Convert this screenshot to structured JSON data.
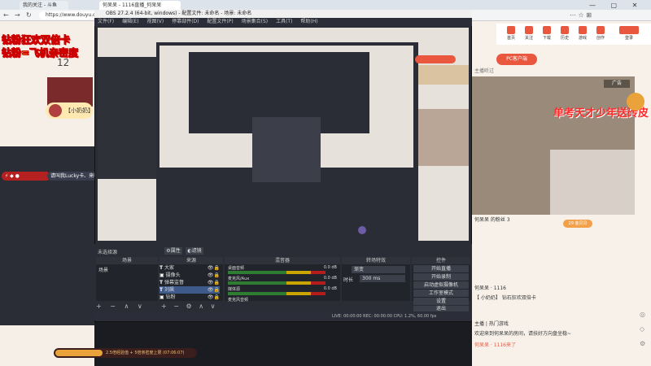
{
  "browser": {
    "tabs": [
      "我的关注 - 斗鱼",
      "何呆呆 - 1116直播_何呆呆",
      "我的关注 - 斗鱼"
    ],
    "url": "https://www.douyu.com/5"
  },
  "douyu": {
    "nav": [
      "首页",
      "关注",
      "下载",
      "历史",
      "游戏",
      "创作",
      "登录"
    ],
    "pc_banner": "PC客户端",
    "host_hint": "主播听过",
    "chat": [
      "何呆呆 的粉丝 3",
      "何呆呆 · 1116",
      "【 小奶奶】 钻石狂欢双倍卡",
      "主播 | 热门游戏",
      "欢迎来到何呆呆的房间，请扶好方向盘坐稳~",
      "何呆呆 · 1116来了"
    ],
    "promo_text": "单考天才少年送砖皮",
    "ad_label": "广告",
    "follower_tag": "29 金贝贝"
  },
  "left": {
    "line1": "钻粉狂欢双倍卡",
    "line2": "钻粉=飞机亲密度",
    "count": "12",
    "user": "【小奶奶】",
    "chat_user": "请叫我Lucky卡、来啦",
    "bottom_bar": "2.5倍经验值 + 5倍亲密度上限 (07:06:07)"
  },
  "obs": {
    "title": "OBS 27.2.4 (64-bit, windows) - 配置文件: 未命名 - 场景: 未命名",
    "menu": [
      "文件(F)",
      "编辑(E)",
      "视图(V)",
      "停靠部件(D)",
      "配置文件(P)",
      "场景集合(S)",
      "工具(T)",
      "帮助(H)"
    ],
    "no_source": "未选择源",
    "props": "属性",
    "filters": "滤镜",
    "docks": [
      "场景",
      "来源",
      "混音器",
      "转场特效",
      "控件"
    ],
    "scene": "场景",
    "sources": [
      "大家",
      "摄像头",
      "弹幕监督",
      "刘飙",
      "钻粉",
      "进人"
    ],
    "mixer": [
      "桌面音频",
      "麦克风/Aux",
      "媒体源",
      "麦克风音频"
    ],
    "mixer_db": [
      "0.0 dB",
      "0.0 dB",
      "0.0 dB"
    ],
    "transition": "渐变",
    "duration_label": "时长",
    "duration": "300 ms",
    "controls": [
      "开始直播",
      "开始录制",
      "启动虚拟摄像机",
      "工作室模式",
      "设置",
      "退出"
    ],
    "status": "LIVE: 00:00:00   REC: 00:00:00   CPU: 1.2%, 60.00 fps"
  },
  "colors": {
    "accent": "#e9573f",
    "obs_bg": "#2a2d35",
    "live_red": "#ff2a2a"
  }
}
